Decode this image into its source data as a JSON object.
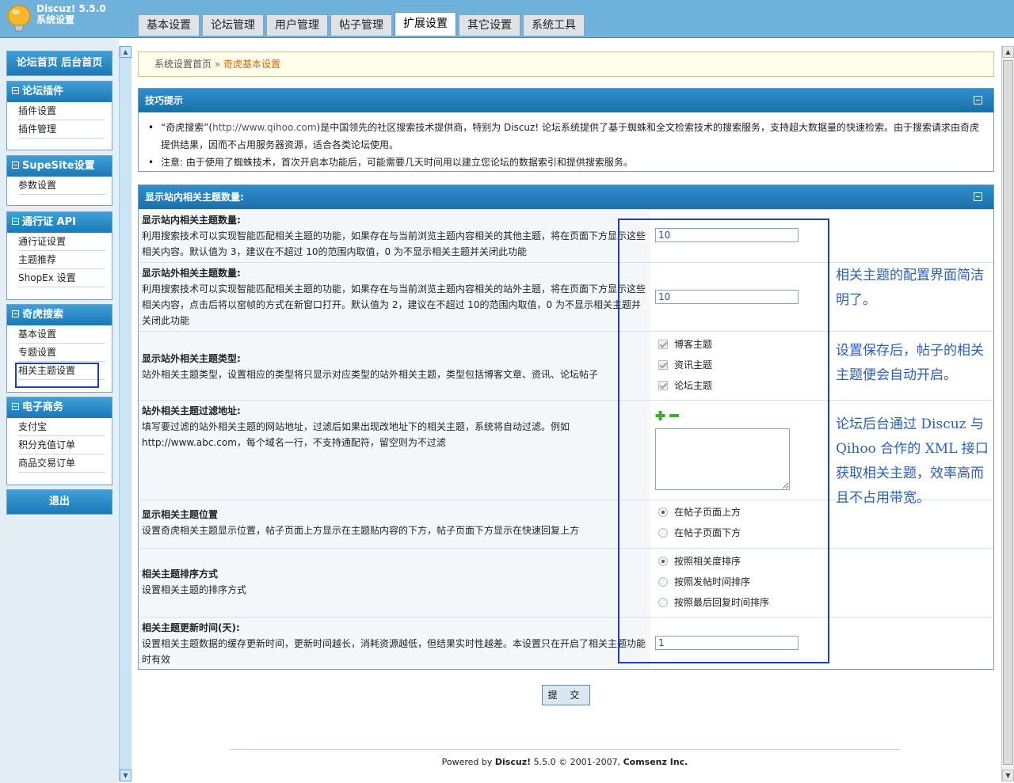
{
  "app": {
    "name": "Discuz! 5.5.0",
    "subtitle": "系统设置"
  },
  "tabs": [
    "基本设置",
    "论坛管理",
    "用户管理",
    "帖子管理",
    "扩展设置",
    "其它设置",
    "系统工具"
  ],
  "active_tab": "扩展设置",
  "sidebar": {
    "top_link": "论坛首页  后台首页",
    "groups": [
      {
        "title": "论坛插件",
        "items": [
          "插件设置",
          "插件管理"
        ]
      },
      {
        "title": "SupeSite设置",
        "items": [
          "参数设置"
        ]
      },
      {
        "title": "通行证  API",
        "items": [
          "通行证设置",
          "主题推荐",
          "ShopEx 设置"
        ]
      },
      {
        "title": "奇虎搜索",
        "items": [
          "基本设置",
          "专题设置",
          "相关主题设置"
        ]
      },
      {
        "title": "电子商务",
        "items": [
          "支付宝",
          "积分充值订单",
          "商品交易订单"
        ]
      }
    ],
    "logout": "退出"
  },
  "breadcrumb": {
    "home": "系统设置首页",
    "sep": "»",
    "current": "奇虎基本设置"
  },
  "tips": {
    "title": "技巧提示",
    "items": [
      {
        "prefix": "“奇虎搜索”(",
        "url": "http://www.qihoo.com",
        "suffix": ")是中国领先的社区搜索技术提供商，特别为 Discuz! 论坛系统提供了基于蜘蛛和全文检索技术的搜索服务，支持超大数据量的快速检索。由于搜索请求由奇虎提供结果，因而不占用服务器资源，适合各类论坛使用。"
      },
      {
        "text": "注意: 由于使用了蜘蛛技术，首次开启本功能后，可能需要几天时间用以建立您论坛的数据索引和提供搜索服务。"
      }
    ]
  },
  "settings": {
    "title": "显示站内相关主题数量:",
    "rows": [
      {
        "label": "显示站内相关主题数量:",
        "desc": "利用搜索技术可以实现智能匹配相关主题的功能，如果存在与当前浏览主题内容相关的其他主题，将在页面下方显示这些相关内容。默认值为 3，建议在不超过 10的范围内取值，0 为不显示相关主题并关闭此功能",
        "value": "10"
      },
      {
        "label": "显示站外相关主题数量:",
        "desc": "利用搜索技术可以实现智能匹配相关主题的功能，如果存在与当前浏览主题内容相关的站外主题，将在页面下方显示这些相关内容，点击后将以窑帧的方式在新窗口打开。默认值为 2，建议在不超过 10的范围内取值，0 为不显示相关主题并关闭此功能",
        "value": "10"
      },
      {
        "label": "显示站外相关主题类型:",
        "desc": "站外相关主题类型，设置相应的类型将只显示对应类型的站外相关主题，类型包括博客文章、资讯、论坛帖子",
        "options": [
          "博客主题",
          "资讯主题",
          "论坛主题"
        ]
      },
      {
        "label": "站外相关主题过滤地址:",
        "desc": "填写要过滤的站外相关主题的网站地址，过滤后如果出现改地址下的相关主题，系统将自动过滤。例如 http://www.abc.com，每个域名一行，不支持通配符，留空则为不过滤",
        "value": ""
      },
      {
        "label": "显示相关主题位置",
        "desc": "设置奇虎相关主题显示位置，帖子页面上方显示在主题贴内容的下方，帖子页面下方显示在快速回复上方",
        "options": [
          "在帖子页面上方",
          "在帖子页面下方"
        ],
        "selected": 0
      },
      {
        "label": "相关主题排序方式",
        "desc": "设置相关主题的排序方式",
        "options": [
          "按照相关度排序",
          "按照发帖时间排序",
          "按照最后回复时间排序"
        ],
        "selected": 0
      },
      {
        "label": "相关主题更新时间(天):",
        "desc": "设置相关主题数据的缓存更新时间，更新时间越长，消耗资源越低，但结果实时性越差。本设置只在开启了相关主题功能时有效",
        "value": "1"
      }
    ]
  },
  "submit_label": "提 交",
  "footer": {
    "prefix": "Powered by ",
    "brand": "Discuz!",
    "version": " 5.5.0  © 2001-2007, ",
    "company": "Comsenz Inc."
  },
  "annotations": [
    "相关主题的配置界面简洁明了。",
    "设置保存后，帖子的相关主题便会自动开启。",
    "论坛后台通过 Discuz 与 Qihoo 合作的 XML 接口获取相关主题，效率高而且不占用带宽。"
  ],
  "colors": {
    "accent": "#1b78b5",
    "annotation": "#2a5fc2",
    "highlight_box": "#1f3fbf",
    "breadcrumb_current": "#e06000"
  }
}
